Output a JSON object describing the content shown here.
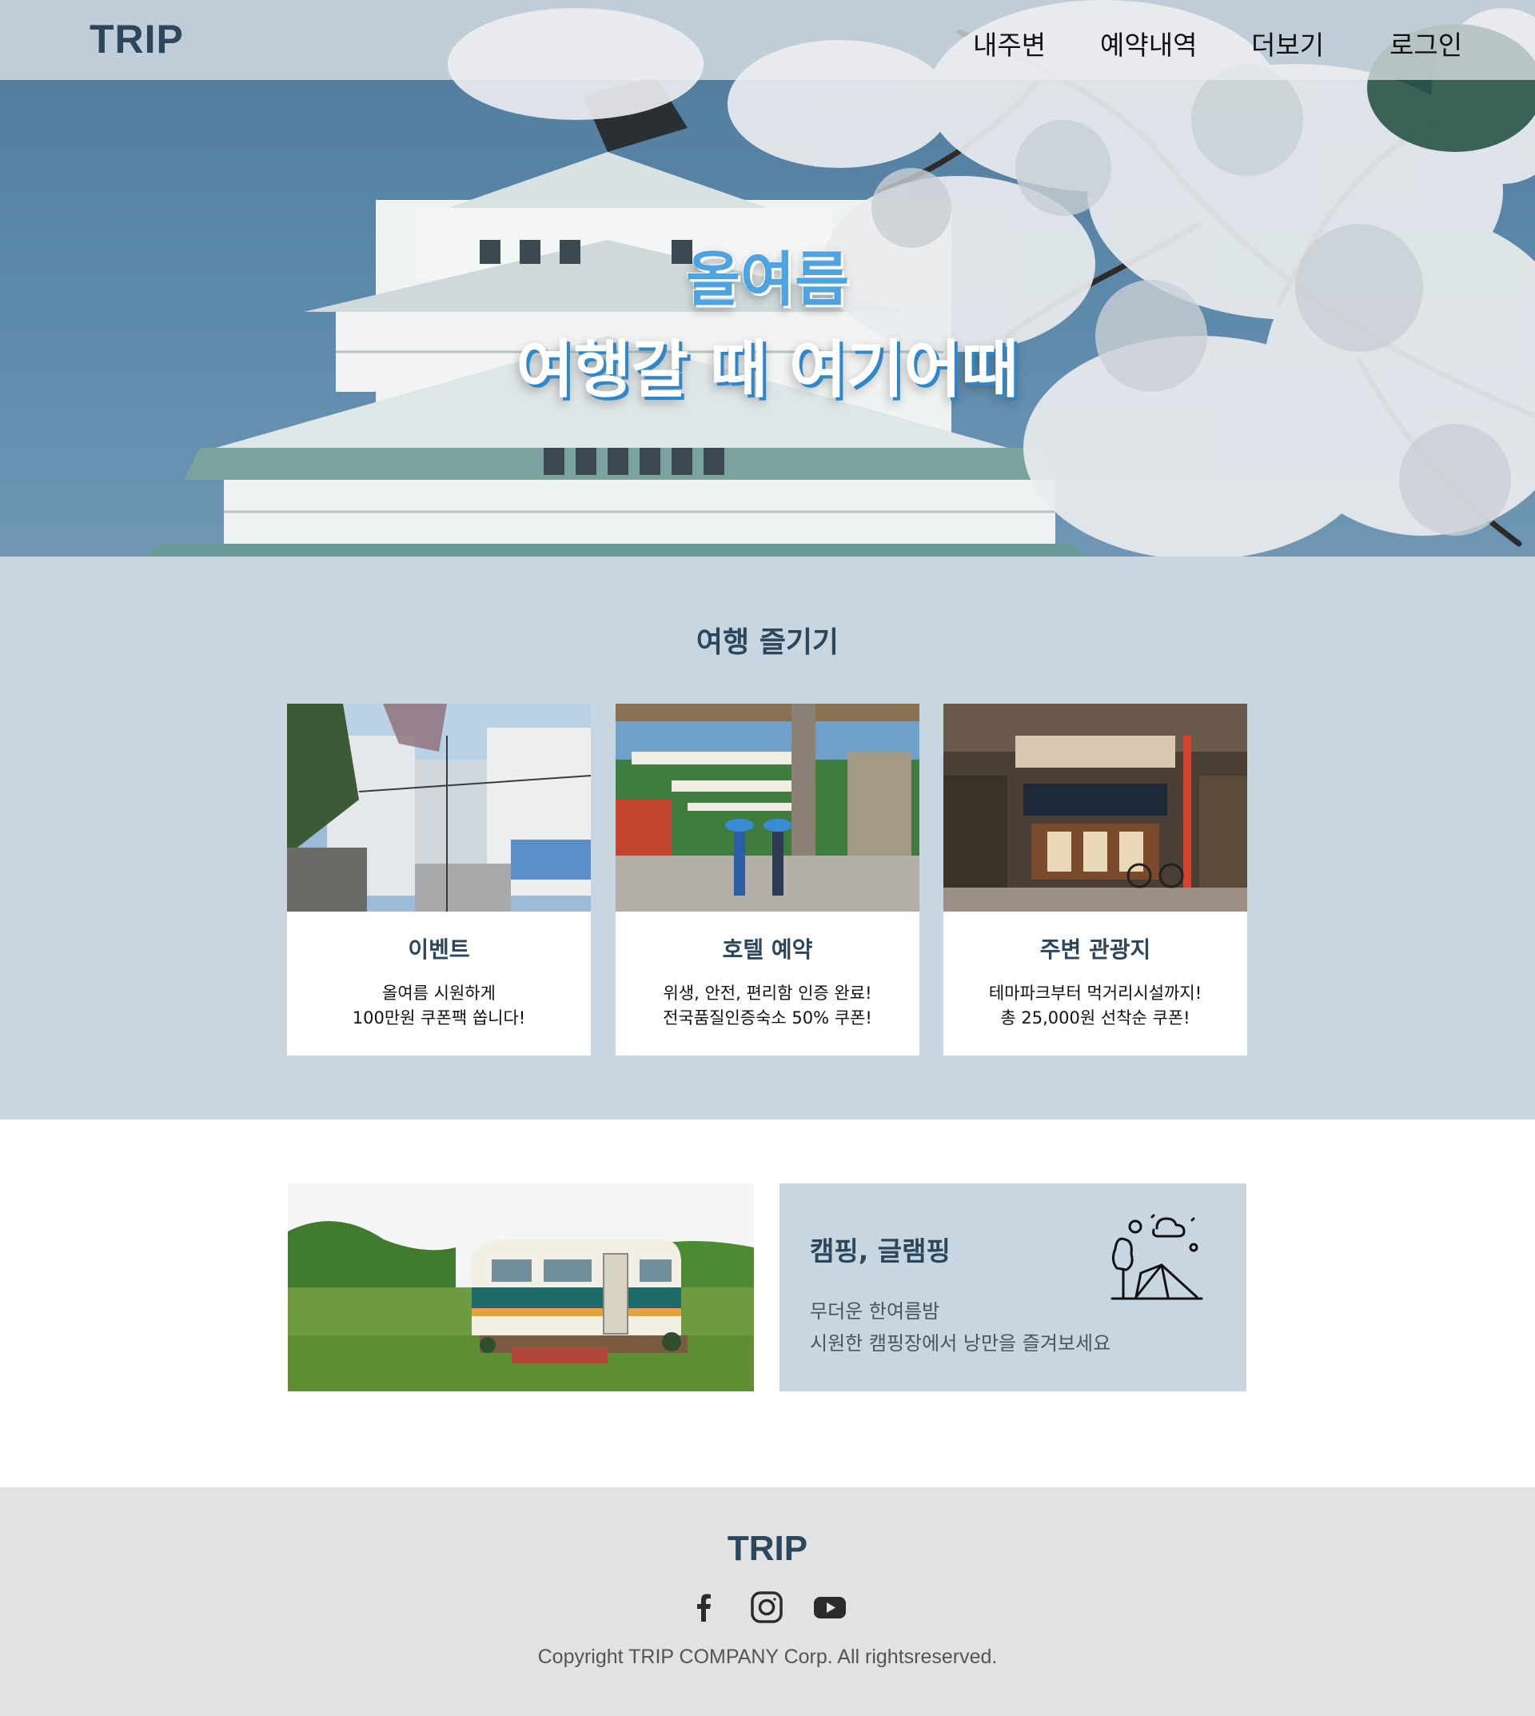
{
  "header": {
    "logo": "TRIP",
    "nav": [
      "내주변",
      "예약내역",
      "더보기",
      "로그인"
    ]
  },
  "hero": {
    "line1": "올여름",
    "line2": "여행갈 때 여기어때"
  },
  "enjoy": {
    "title": "여행 즐기기",
    "cards": [
      {
        "title": "이벤트",
        "lines": [
          "올여름 시원하게",
          "100만원 쿠폰팩 쏩니다!"
        ]
      },
      {
        "title": "호텔 예약",
        "lines": [
          "위생, 안전, 편리함 인증 완료!",
          "전국품질인증숙소 50% 쿠폰!"
        ]
      },
      {
        "title": "주변 관광지",
        "lines": [
          "테마파크부터 먹거리시설까지!",
          "총 25,000원 선착순 쿠폰!"
        ]
      }
    ]
  },
  "camping": {
    "title": "캠핑, 글램핑",
    "lines": [
      "무더운 한여름밤",
      "시원한 캠핑장에서 낭만을 즐겨보세요"
    ],
    "icon": "camping-tent-icon"
  },
  "footer": {
    "logo": "TRIP",
    "social": [
      "facebook-icon",
      "instagram-icon",
      "youtube-icon"
    ],
    "copyright": "Copyright TRIP COMPANY Corp. All rightsreserved."
  },
  "colors": {
    "brand": "#2c465c",
    "section_bg": "#c7d6e1",
    "footer_bg": "#e1e2e3",
    "hero_accent": "#4ea3e0"
  }
}
